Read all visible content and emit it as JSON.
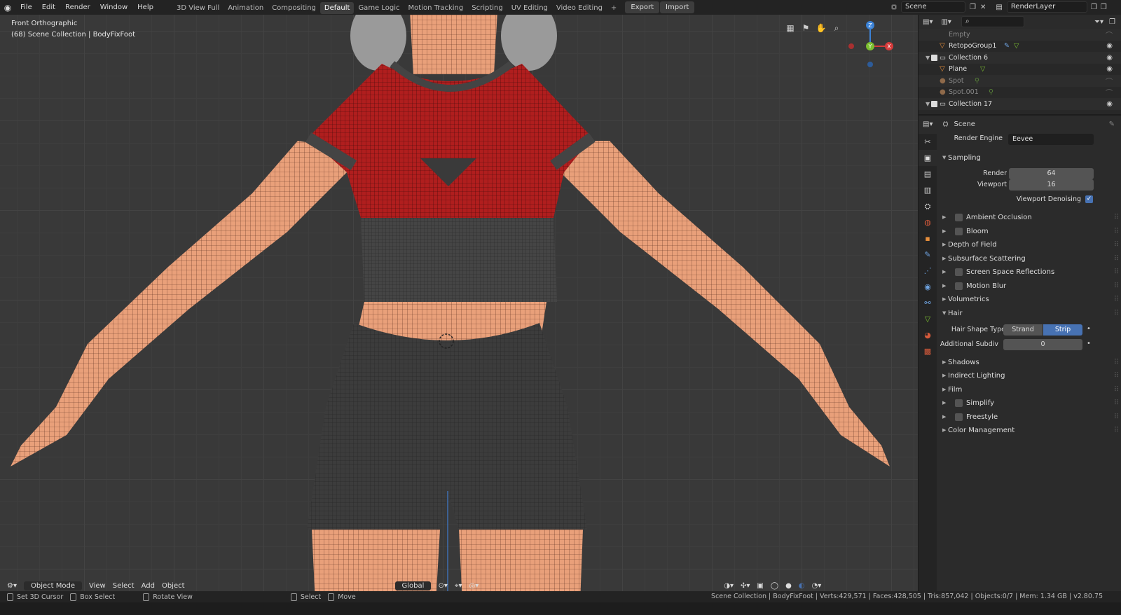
{
  "menu": [
    "File",
    "Edit",
    "Render",
    "Window",
    "Help"
  ],
  "workspaces": [
    "3D View Full",
    "Animation",
    "Compositing",
    "Default",
    "Game Logic",
    "Motion Tracking",
    "Scripting",
    "UV Editing",
    "Video Editing"
  ],
  "active_workspace": "Default",
  "export_label": "Export",
  "import_label": "Import",
  "scene_name": "Scene",
  "render_layer": "RenderLayer",
  "viewport": {
    "title": "Front Orthographic",
    "subtitle": "(68) Scene Collection | BodyFixFoot"
  },
  "gizmo": {
    "z": "Z",
    "y": "Y",
    "x": "X"
  },
  "bottom_toolbar": {
    "mode": "Object Mode",
    "view": "View",
    "select": "Select",
    "add": "Add",
    "object": "Object",
    "orientation": "Global"
  },
  "statusbar": {
    "cursor": "Set 3D Cursor",
    "box": "Box Select",
    "rotate": "Rotate View",
    "select": "Select",
    "move": "Move",
    "stats": "Scene Collection | BodyFixFoot | Verts:429,571 | Faces:428,505 | Tris:857,042 | Objects:0/7 | Mem: 1.34 GB | v2.80.75"
  },
  "outliner": [
    {
      "label": "Empty",
      "dim": true
    },
    {
      "label": "RetopoGroup1",
      "dim": false
    },
    {
      "label": "Collection 6",
      "dim": false
    },
    {
      "label": "Plane",
      "dim": false
    },
    {
      "label": "Spot",
      "dim": true
    },
    {
      "label": "Spot.001",
      "dim": true
    },
    {
      "label": "Collection 17",
      "dim": false
    }
  ],
  "properties": {
    "context": "Scene",
    "render_engine_label": "Render Engine",
    "render_engine": "Eevee",
    "sampling": "Sampling",
    "render_label": "Render",
    "render_value": "64",
    "viewport_label": "Viewport",
    "viewport_value": "16",
    "denoise_label": "Viewport Denoising",
    "panels": [
      "Ambient Occlusion",
      "Bloom",
      "Depth of Field",
      "Subsurface Scattering",
      "Screen Space Reflections",
      "Motion Blur",
      "Volumetrics",
      "Hair"
    ],
    "hair_shape_label": "Hair Shape Type",
    "strand": "Strand",
    "strip": "Strip",
    "subdiv_label": "Additional Subdiv",
    "subdiv_value": "0",
    "panels2": [
      "Shadows",
      "Indirect Lighting",
      "Film",
      "Simplify",
      "Freestyle",
      "Color Management"
    ]
  },
  "colors": {
    "accent": "#4772b3",
    "shirt": "#a81c1c",
    "skin": "#e9a07a",
    "shorts": "#3a3a3a"
  }
}
